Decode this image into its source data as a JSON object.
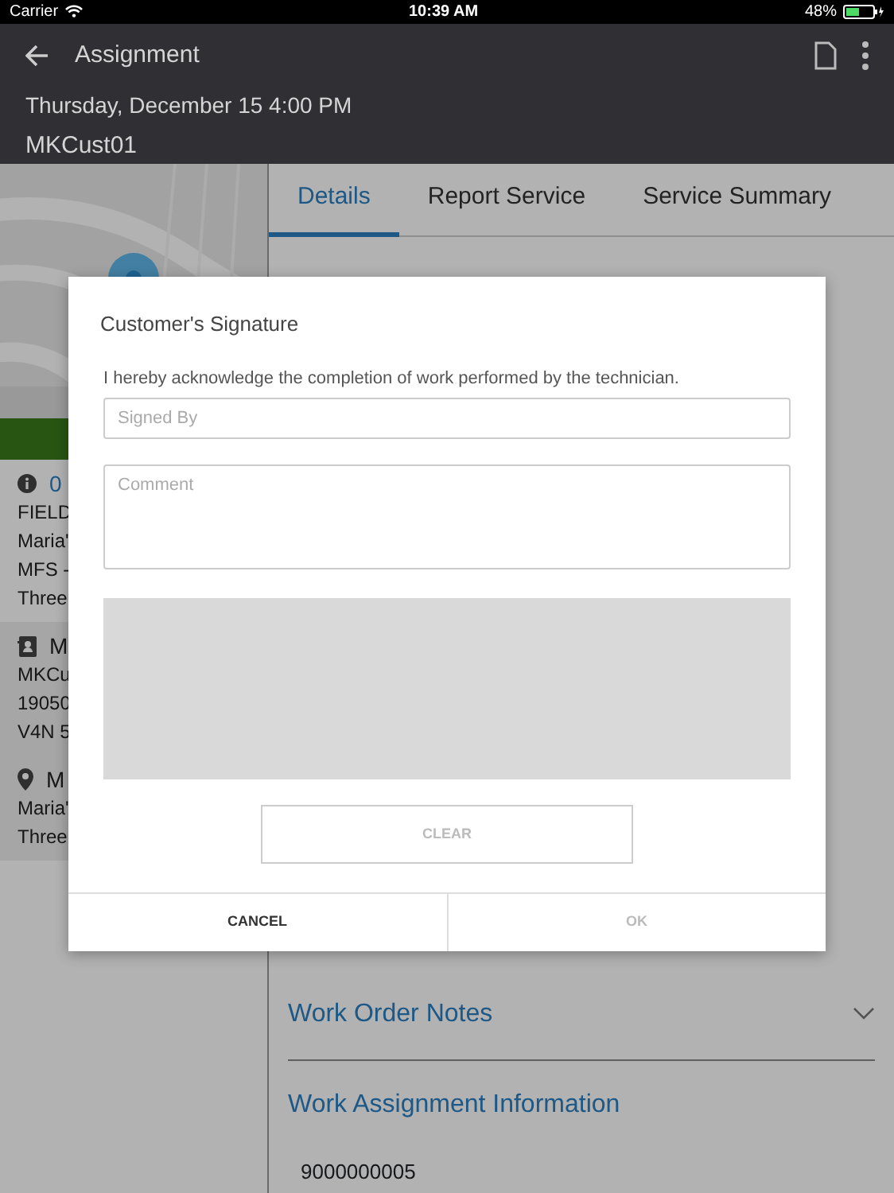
{
  "status_bar": {
    "carrier": "Carrier",
    "time": "10:39 AM",
    "battery": "48%"
  },
  "header": {
    "title": "Assignment",
    "date": "Thursday, December 15 4:00 PM",
    "customer": "MKCust01"
  },
  "left_panel": {
    "sections": [
      {
        "kind": "info",
        "title": "0",
        "lines": [
          "FIELD",
          "Maria'",
          "MFS -",
          "Three"
        ]
      },
      {
        "kind": "contact",
        "title": "M",
        "lines": [
          "MKCu",
          "19050",
          "V4N 5"
        ]
      },
      {
        "kind": "location",
        "title": "M",
        "lines": [
          "Maria'",
          "Three"
        ]
      }
    ]
  },
  "tabs": [
    {
      "label": "Details",
      "selected": true
    },
    {
      "label": "Report Service",
      "selected": false
    },
    {
      "label": "Service Summary",
      "selected": false
    }
  ],
  "details": {
    "sections": [
      {
        "title": "Work Order Notes",
        "expandable": true
      },
      {
        "title": "Work Assignment Information",
        "expandable": false
      }
    ],
    "value": "9000000005"
  },
  "dialog": {
    "title": "Customer's Signature",
    "instruction": "I hereby acknowledge the completion of work performed by the technician.",
    "signed_by": {
      "placeholder": "Signed By"
    },
    "comment": {
      "placeholder": "Comment"
    },
    "clear": {
      "label": "CLEAR",
      "disabled": true
    },
    "buttons": [
      {
        "label": "CANCEL",
        "disabled": false
      },
      {
        "label": "OK",
        "disabled": true
      }
    ]
  }
}
